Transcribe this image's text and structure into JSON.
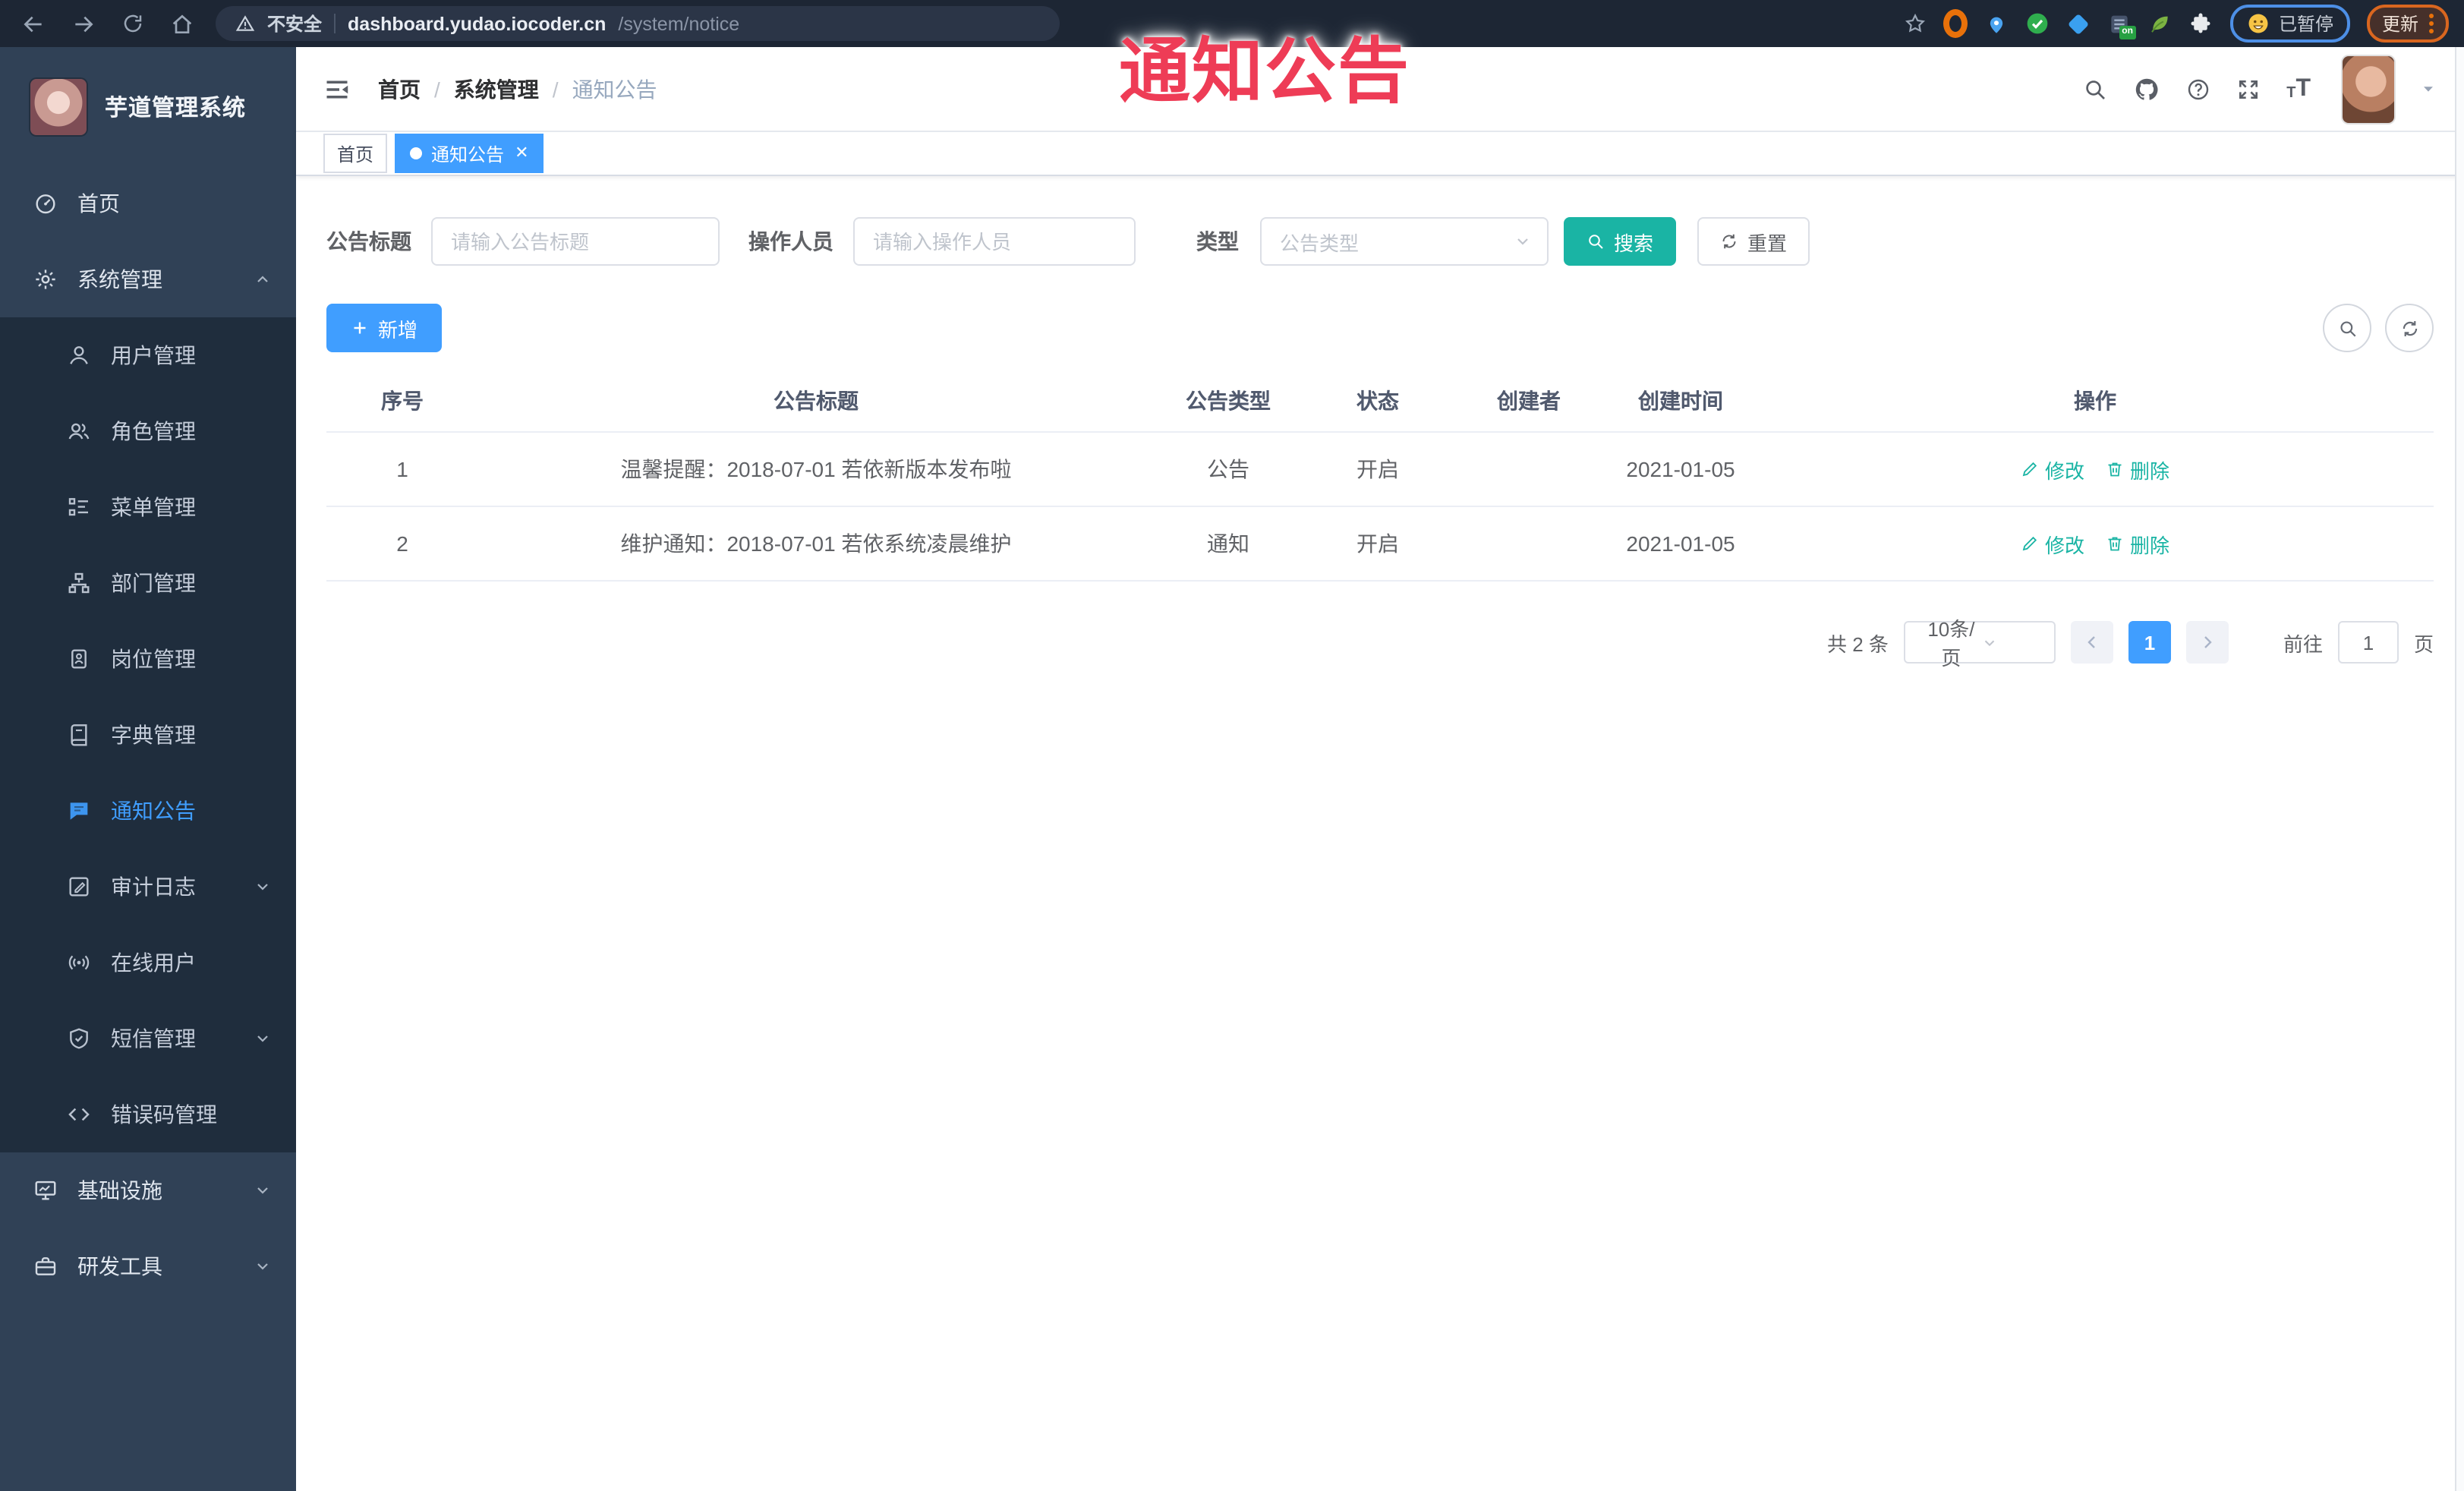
{
  "overlay": {
    "title": "通知公告"
  },
  "browser": {
    "security_label": "不安全",
    "url_host": "dashboard.yudao.iocoder.cn",
    "url_path": "/system/notice",
    "extension_badge": "on",
    "paused_label": "已暂停",
    "update_label": "更新"
  },
  "sidebar": {
    "logo_title": "芋道管理系统",
    "items": [
      {
        "label": "首页"
      },
      {
        "label": "系统管理"
      },
      {
        "label": "用户管理"
      },
      {
        "label": "角色管理"
      },
      {
        "label": "菜单管理"
      },
      {
        "label": "部门管理"
      },
      {
        "label": "岗位管理"
      },
      {
        "label": "字典管理"
      },
      {
        "label": "通知公告"
      },
      {
        "label": "审计日志"
      },
      {
        "label": "在线用户"
      },
      {
        "label": "短信管理"
      },
      {
        "label": "错误码管理"
      },
      {
        "label": "基础设施"
      },
      {
        "label": "研发工具"
      }
    ]
  },
  "navbar": {
    "breadcrumb": {
      "0": "首页",
      "1": "系统管理",
      "2": "通知公告"
    }
  },
  "tabs": [
    {
      "label": "首页"
    },
    {
      "label": "通知公告"
    }
  ],
  "filters": {
    "title_label": "公告标题",
    "title_placeholder": "请输入公告标题",
    "operator_label": "操作人员",
    "operator_placeholder": "请输入操作人员",
    "type_label": "类型",
    "type_placeholder": "公告类型",
    "search_label": "搜索",
    "reset_label": "重置"
  },
  "toolbar": {
    "add_label": "新增"
  },
  "table": {
    "headers": [
      "序号",
      "公告标题",
      "公告类型",
      "状态",
      "创建者",
      "创建时间",
      "操作"
    ],
    "edit_label": "修改",
    "delete_label": "删除",
    "rows": [
      {
        "no": "1",
        "title": "温馨提醒：2018-07-01 若依新版本发布啦",
        "type": "公告",
        "status": "开启",
        "creator": "",
        "created": "2021-01-05"
      },
      {
        "no": "2",
        "title": "维护通知：2018-07-01 若依系统凌晨维护",
        "type": "通知",
        "status": "开启",
        "creator": "",
        "created": "2021-01-05"
      }
    ]
  },
  "pagination": {
    "total_text": "共 2 条",
    "page_size": "10条/页",
    "current_page": "1",
    "goto_label": "前往",
    "goto_value": "1",
    "page_unit": "页"
  },
  "colors": {
    "primary_blue": "#409eff",
    "search_teal": "#1ab4a4",
    "sidebar_bg": "#304156",
    "submenu_bg": "#1f2d3d",
    "overlay_red": "#ee3c56",
    "browser_bar_bg": "#1d2634"
  }
}
